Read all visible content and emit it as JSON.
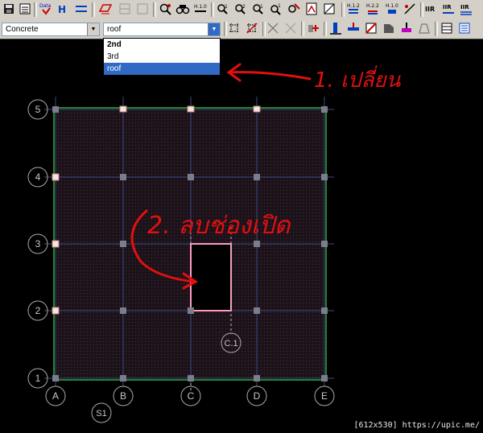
{
  "toolbar": {
    "icons": [
      "save-icon",
      "properties-icon",
      "data-check-icon",
      "h-section-icon",
      "beam-icon",
      "slab-icon",
      "opening-icon",
      "zoom-icon",
      "find-icon",
      "h-1-0-icon",
      "query-1-icon",
      "query-2-icon",
      "query-3-icon",
      "query-4-icon",
      "query-5-icon",
      "report-icon",
      "dim-icon",
      "h-1-2-icon",
      "h-2-2-icon",
      "h-1-0b-icon",
      "measure-icon",
      "iir-1-icon",
      "iir-2-icon",
      "iir-3-icon"
    ]
  },
  "toolbar2": {
    "material_select": "Concrete",
    "level_select": "roof",
    "icons": [
      "grid-icon",
      "delete-grid-icon",
      "cross-icon",
      "cross-check-icon",
      "add-icon",
      "column-icon",
      "beam-load-icon",
      "slab-edit-icon",
      "wall-icon",
      "load-icon",
      "trapezoid-icon",
      "table-icon",
      "list-icon"
    ]
  },
  "dropdown": {
    "options": [
      "2nd",
      "3rd",
      "roof"
    ],
    "selected": "roof"
  },
  "drawing": {
    "row_labels": [
      "5",
      "4",
      "3",
      "2",
      "1"
    ],
    "column_labels": [
      "A",
      "B",
      "C",
      "D",
      "E"
    ],
    "opening_label": "C.1",
    "section_label": "S1",
    "annotation_1": "1. เปลี่ยน",
    "annotation_2": "2. ลบช่องเปิด",
    "colors": {
      "background": "#000000",
      "slab_fill": "#24141f",
      "grid_line": "#3a4a8a",
      "boundary": "#2fb22f",
      "column": "#7d7d8a",
      "beam_support": "#f2e6e6",
      "opening": "#ff9bc4",
      "annotation": "#e01010",
      "label": "#c8c8c8"
    }
  },
  "watermark": "[612x530] https://upic.me/"
}
